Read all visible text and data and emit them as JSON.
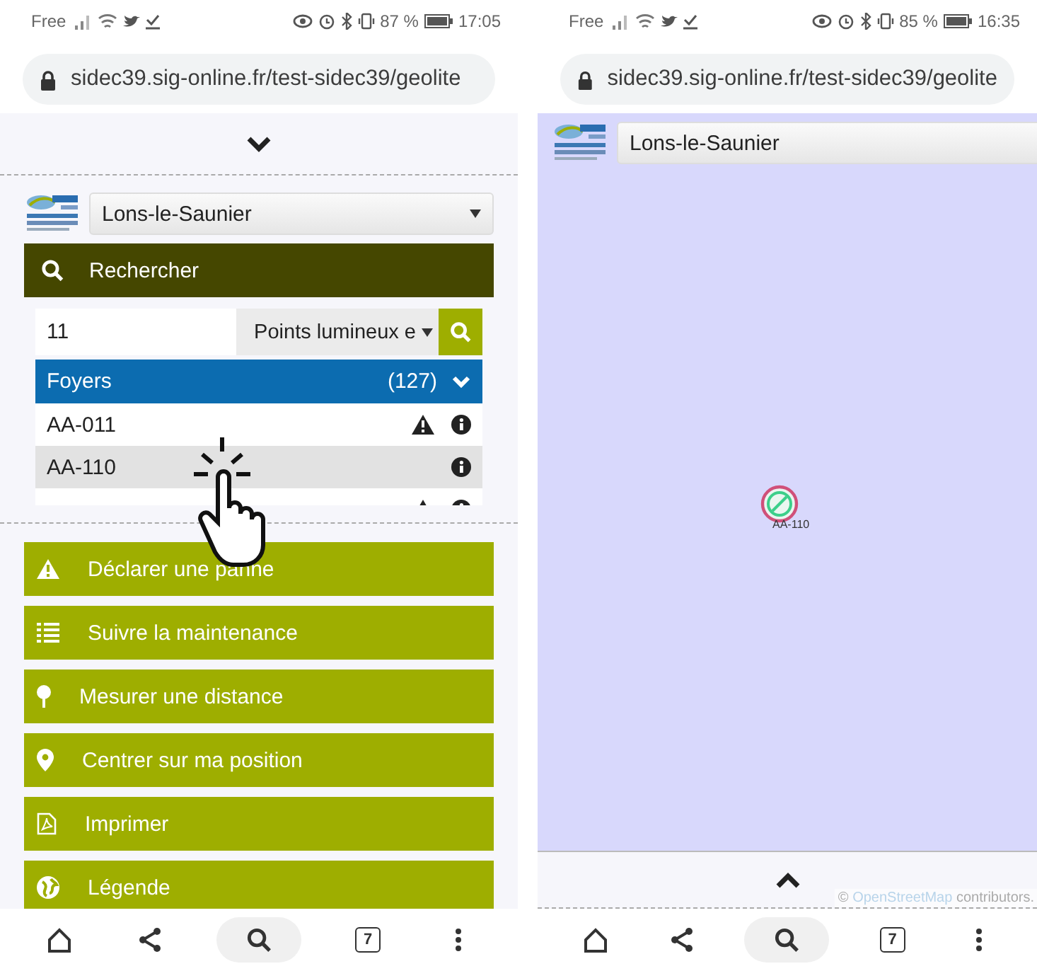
{
  "phones": [
    {
      "kind": "menu",
      "status_bar": {
        "carrier": "Free",
        "battery": "87 %",
        "time": "17:05"
      },
      "url": "sidec39.sig-online.fr/test-sidec39/geolite",
      "commune": "Lons-le-Saunier",
      "search": {
        "title": "Rechercher",
        "value": "11",
        "layer": "Points lumineux e"
      },
      "results": {
        "group": "Foyers",
        "count": "(127)",
        "expanded": true,
        "rows": [
          {
            "label": "AA-011",
            "warning": true,
            "selected": false
          },
          {
            "label": "AA-110",
            "warning": false,
            "selected": true
          },
          {
            "warning": true,
            "selected": false
          }
        ]
      },
      "menu": [
        {
          "label": "Déclarer une panne",
          "kind": "warning"
        },
        {
          "label": "Suivre la maintenance",
          "kind": "list"
        },
        {
          "label": "Mesurer une distance",
          "kind": "pin"
        },
        {
          "label": "Centrer sur ma position",
          "kind": "marker"
        },
        {
          "label": "Imprimer",
          "kind": "pdf"
        },
        {
          "label": "Légende",
          "kind": "globe"
        }
      ],
      "tabs_count": "7"
    },
    {
      "kind": "map",
      "status_bar": {
        "carrier": "Free",
        "battery": "85 %",
        "time": "16:35"
      },
      "url": "sidec39.sig-online.fr/test-sidec39/geolite",
      "commune": "Lons-le-Saunier",
      "marker": {
        "label": "AA-110"
      },
      "attribution": {
        "prefix": "©",
        "link": "OpenStreetMap",
        "suffix": "contributors."
      },
      "tabs_count": "7"
    }
  ]
}
